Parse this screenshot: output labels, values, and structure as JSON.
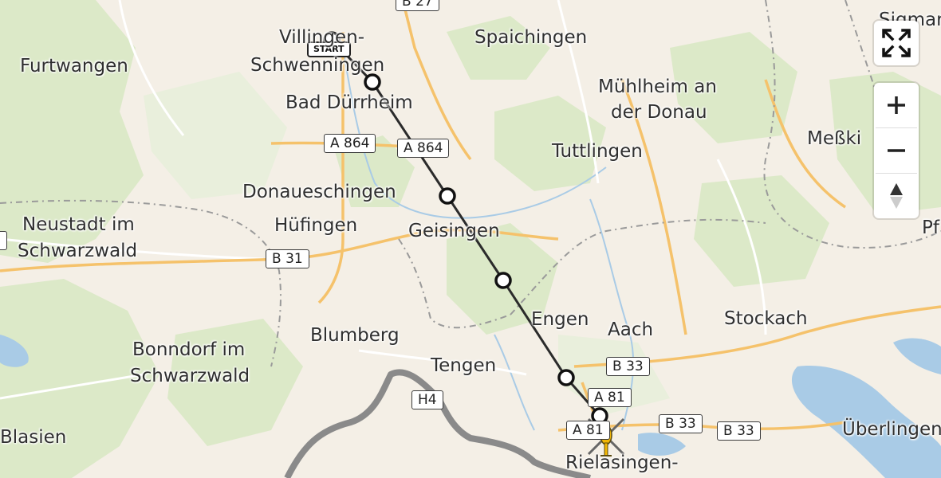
{
  "map": {
    "places": {
      "villingen": "Villingen-",
      "schwenningen": "Schwenningen",
      "spaichingen": "Spaichingen",
      "furtwangen": "Furtwangen",
      "bad_duerrheim": "Bad Dürrheim",
      "muehlheim_1": "Mühlheim an",
      "muehlheim_2": "der Donau",
      "tuttlingen": "Tuttlingen",
      "messkirch": "Meßki",
      "sigmaringen": "Sigmar",
      "donaueschingen": "Donaueschingen",
      "neustadt_1": "Neustadt im",
      "neustadt_2": "Schwarzwald",
      "huefingen": "Hüfingen",
      "geisingen": "Geisingen",
      "pf": "Pf",
      "engen": "Engen",
      "aach": "Aach",
      "stockach": "Stockach",
      "blumberg": "Blumberg",
      "bonndorf_1": "Bonndorf im",
      "bonndorf_2": "Schwarzwald",
      "tengen": "Tengen",
      "blasien": "Blasien",
      "ueberlingen": "Überlingen",
      "rielasingen": "Rielasingen-"
    },
    "road_shields": {
      "a864_1": "A 864",
      "a864_2": "A 864",
      "b31": "B 31",
      "b33_1": "B 33",
      "b33_2": "B 33",
      "b33_3": "B 33",
      "h4": "H4",
      "a81_1": "A 81",
      "a81_2": "A 81",
      "b27": "B 27"
    },
    "start_label": "START",
    "colors": {
      "land": "#f4efe6",
      "forest": "#d9e8c6",
      "water": "#a9cbe6",
      "motorway": "#f5c26b",
      "route_line": "#2b2b2b",
      "border": "#8c8c8c",
      "swiss_border": "#888888",
      "helicopter": "#f2b705"
    },
    "route": {
      "from": "Villingen-Schwenningen",
      "to": "Rielasingen-Worblingen",
      "waypoints": 6
    }
  },
  "controls": {
    "fullscreen_icon": "fullscreen-icon",
    "zoom_in_icon": "plus-icon",
    "zoom_out_icon": "minus-icon",
    "compass_icon": "compass-icon"
  }
}
